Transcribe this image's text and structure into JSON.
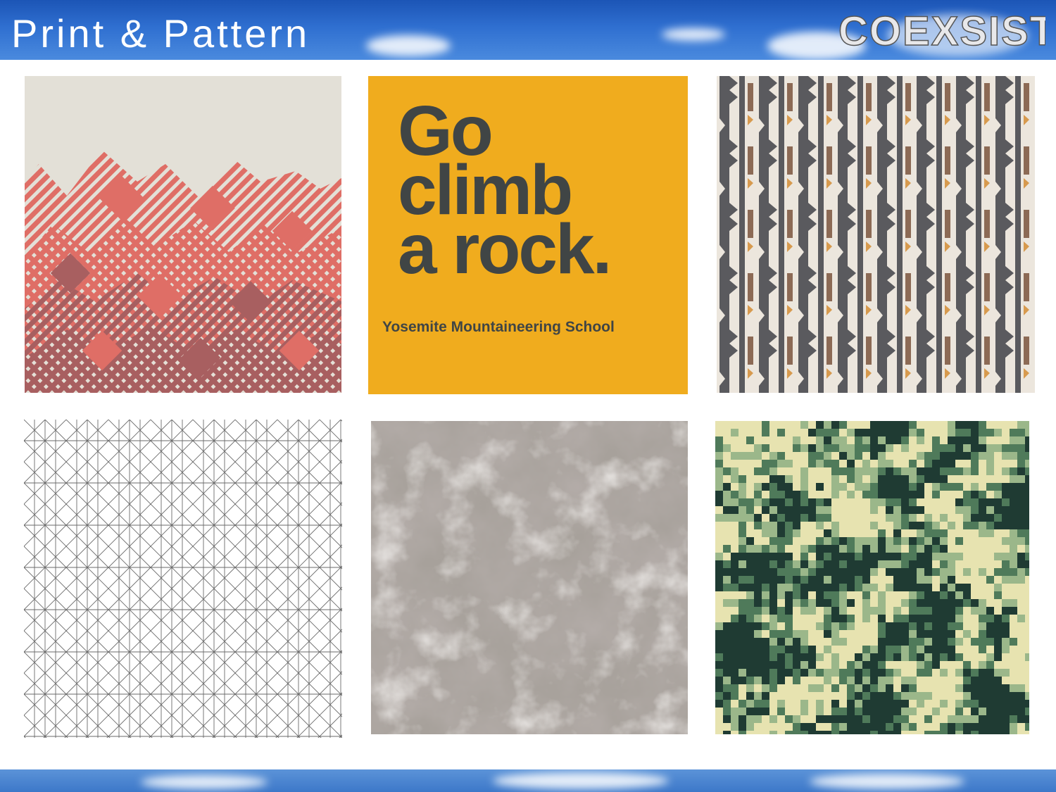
{
  "slide": {
    "title": "Print & Pattern",
    "brand": "COEXSIST"
  },
  "tiles": [
    {
      "name": "mountain-stripes-pattern",
      "colors": [
        "#e3e0d7",
        "#df6e66",
        "#a85f60"
      ]
    },
    {
      "name": "go-climb-a-rock-shirt",
      "lines": [
        "Go",
        "climb",
        "a rock."
      ],
      "subtitle": "Yosemite Mountaineering School",
      "colors": [
        "#f0ac1e",
        "#404545"
      ]
    },
    {
      "name": "tribal-stripe-pattern",
      "colors": [
        "#ece6dd",
        "#5a5a5e",
        "#8c6a55",
        "#d79a4e"
      ]
    },
    {
      "name": "geometric-line-pattern",
      "colors": [
        "#ffffff",
        "#6a6a6a"
      ]
    },
    {
      "name": "marble-texture",
      "colors": [
        "#6e645f",
        "#a9a39d",
        "#d8d4cf"
      ]
    },
    {
      "name": "digital-camo-pattern",
      "colors": [
        "#1f3b33",
        "#4f7a5a",
        "#9bb78a",
        "#e7e3b0"
      ]
    }
  ]
}
